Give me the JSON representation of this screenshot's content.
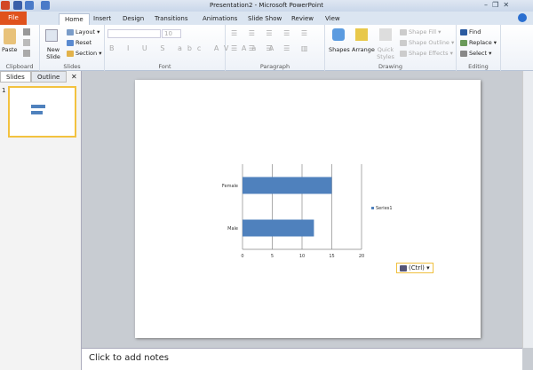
{
  "window": {
    "title": "Presentation2 - Microsoft PowerPoint"
  },
  "tabs": [
    "File",
    "Home",
    "Insert",
    "Design",
    "Transitions",
    "Animations",
    "Slide Show",
    "Review",
    "View"
  ],
  "ribbon": {
    "clipboard": {
      "label": "Clipboard",
      "paste": "Paste"
    },
    "slides": {
      "label": "Slides",
      "new_slide": "New Slide",
      "layout": "Layout",
      "reset": "Reset",
      "section": "Section"
    },
    "font": {
      "label": "Font",
      "font_name": "",
      "font_size": "10"
    },
    "paragraph": {
      "label": "Paragraph"
    },
    "drawing": {
      "label": "Drawing",
      "shapes": "Shapes",
      "arrange": "Arrange",
      "quick_styles": "Quick Styles",
      "shape_fill": "Shape Fill",
      "shape_outline": "Shape Outline",
      "shape_effects": "Shape Effects"
    },
    "editing": {
      "label": "Editing",
      "find": "Find",
      "replace": "Replace",
      "select": "Select"
    }
  },
  "panel": {
    "tabs": [
      "Slides",
      "Outline"
    ],
    "slide_number": "1"
  },
  "notes": {
    "placeholder": "Click to add notes"
  },
  "paste_options": {
    "label": "(Ctrl)"
  },
  "chart_data": {
    "type": "bar",
    "orientation": "horizontal",
    "categories": [
      "Male",
      "Female"
    ],
    "series": [
      {
        "name": "Series1",
        "values": [
          12,
          15
        ],
        "color": "#4f81bd"
      }
    ],
    "xlim": [
      0,
      20
    ],
    "xticks": [
      0,
      5,
      10,
      15,
      20
    ],
    "grid": true,
    "legend": "right"
  }
}
